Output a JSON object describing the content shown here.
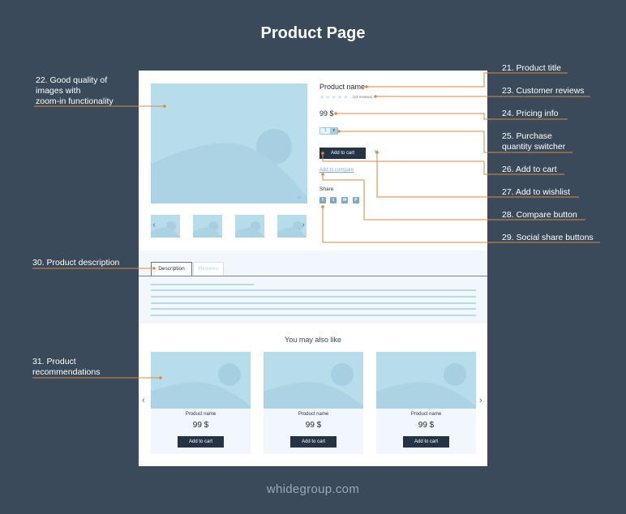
{
  "title": "Product Page",
  "footer": "whidegroup.com",
  "colors": {
    "background": "#3a4a5b",
    "accent_orange": "#e0893a",
    "placeholder_blue": "#b7dcea",
    "button_dark": "#243444"
  },
  "product": {
    "name": "Product name",
    "stars_icon": "star-icon",
    "rating_stars": "★★★★★",
    "reviews": "(23 reviews)",
    "price": "99 $",
    "quantity": "1",
    "quantity_dropdown_icon": "▾",
    "add_to_cart": "Add to cart",
    "wishlist_icon": "♥",
    "compare": "Add to compare",
    "share_label": "Share",
    "social": [
      {
        "name": "facebook",
        "glyph": "f"
      },
      {
        "name": "twitter",
        "glyph": "t"
      },
      {
        "name": "email",
        "glyph": "✉"
      },
      {
        "name": "pinterest",
        "glyph": "P"
      }
    ],
    "gallery": {
      "zoom_icon": "⌕",
      "prev_arrow": "‹",
      "next_arrow": "›",
      "thumbnail_count": 4
    }
  },
  "tabs": [
    {
      "label": "Description",
      "active": true
    },
    {
      "label": "Reviews",
      "active": false
    }
  ],
  "recommendations": {
    "heading": "You may also like",
    "prev_arrow": "‹",
    "next_arrow": "›",
    "items": [
      {
        "name": "Product name",
        "price": "99 $",
        "button": "Add to cart"
      },
      {
        "name": "Product name",
        "price": "99 $",
        "button": "Add to cart"
      },
      {
        "name": "Product name",
        "price": "99 $",
        "button": "Add to cart"
      }
    ]
  },
  "callouts": {
    "c21": "21. Product title",
    "c22": [
      "22. Good quality of",
      "images with",
      "zoom-in functionality"
    ],
    "c23": "23. Customer reviews",
    "c24": "24. Pricing info",
    "c25": [
      "25. Purchase",
      "quantity switcher"
    ],
    "c26": "26. Add to cart",
    "c27": "27. Add to wishlist",
    "c28": "28. Compare button",
    "c29": "29. Social share buttons",
    "c30": "30. Product description",
    "c31": [
      "31. Product",
      "recommendations"
    ]
  }
}
